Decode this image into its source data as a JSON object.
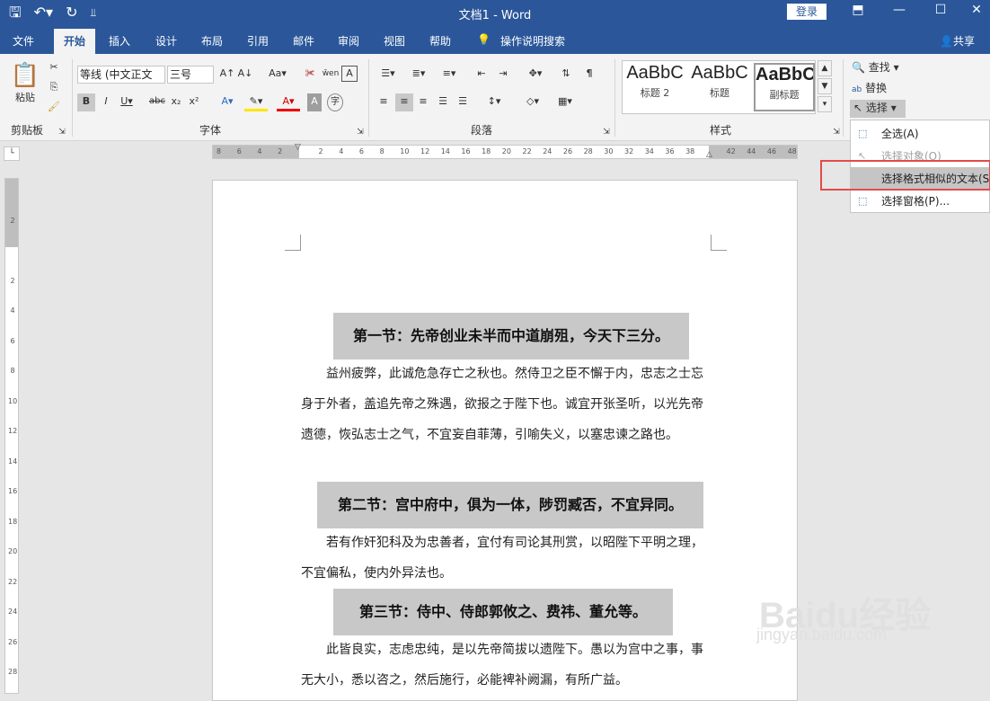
{
  "window": {
    "title": "文档1 - Word",
    "login": "登录",
    "share": "共享"
  },
  "tabs": [
    "文件",
    "开始",
    "插入",
    "设计",
    "布局",
    "引用",
    "邮件",
    "审阅",
    "视图",
    "帮助",
    "操作说明搜索"
  ],
  "ribbon": {
    "clipboard": {
      "label": "剪贴板",
      "paste": "粘贴"
    },
    "font": {
      "label": "字体",
      "name": "等线 (中文正文",
      "size": "三号"
    },
    "paragraph": {
      "label": "段落"
    },
    "styles": {
      "label": "样式",
      "items": [
        {
          "sample": "AaBbC",
          "name": "标题 2"
        },
        {
          "sample": "AaBbC",
          "name": "标题"
        },
        {
          "sample": "AaBbC",
          "name": "副标题"
        }
      ]
    },
    "editing": {
      "find": "查找",
      "replace": "替换",
      "select": "选择"
    }
  },
  "select_menu": {
    "items": [
      {
        "label": "全选(A)"
      },
      {
        "label": "选择对象(O)"
      },
      {
        "label": "选择格式相似的文本(S)"
      },
      {
        "label": "选择窗格(P)..."
      }
    ]
  },
  "ruler": {
    "ticks": [
      "8",
      "6",
      "4",
      "2",
      "",
      "2",
      "4",
      "6",
      "8",
      "10",
      "12",
      "14",
      "16",
      "18",
      "20",
      "22",
      "24",
      "26",
      "28",
      "30",
      "32",
      "34",
      "36",
      "38",
      "",
      "42",
      "44",
      "46",
      "48"
    ]
  },
  "vruler": {
    "ticks": [
      "",
      "2",
      "",
      "2",
      "4",
      "6",
      "8",
      "10",
      "12",
      "14",
      "16",
      "18",
      "20",
      "22",
      "24",
      "26",
      "28"
    ]
  },
  "document": {
    "heading1": "第一节：先帝创业未半而中道崩殂，今天下三分。",
    "para1": "益州疲弊，此诚危急存亡之秋也。然侍卫之臣不懈于内，忠志之士忘身于外者，盖追先帝之殊遇，欲报之于陛下也。诚宜开张圣听，以光先帝遗德，恢弘志士之气，不宜妄自菲薄，引喻失义，以塞忠谏之路也。",
    "heading2": "第二节：宫中府中，俱为一体，陟罚臧否，不宜异同。",
    "para2": "若有作奸犯科及为忠善者，宜付有司论其刑赏，以昭陛下平明之理，不宜偏私，使内外异法也。",
    "heading3": "第三节：侍中、侍郎郭攸之、费祎、董允等。",
    "para3": "此皆良实，志虑忠纯，是以先帝简拔以遗陛下。愚以为宫中之事，事无大小，悉以咨之，然后施行，必能裨补阙漏，有所广益。"
  },
  "watermark": {
    "brand": "Baidu经验",
    "url": "jingyan.baidu.com"
  }
}
